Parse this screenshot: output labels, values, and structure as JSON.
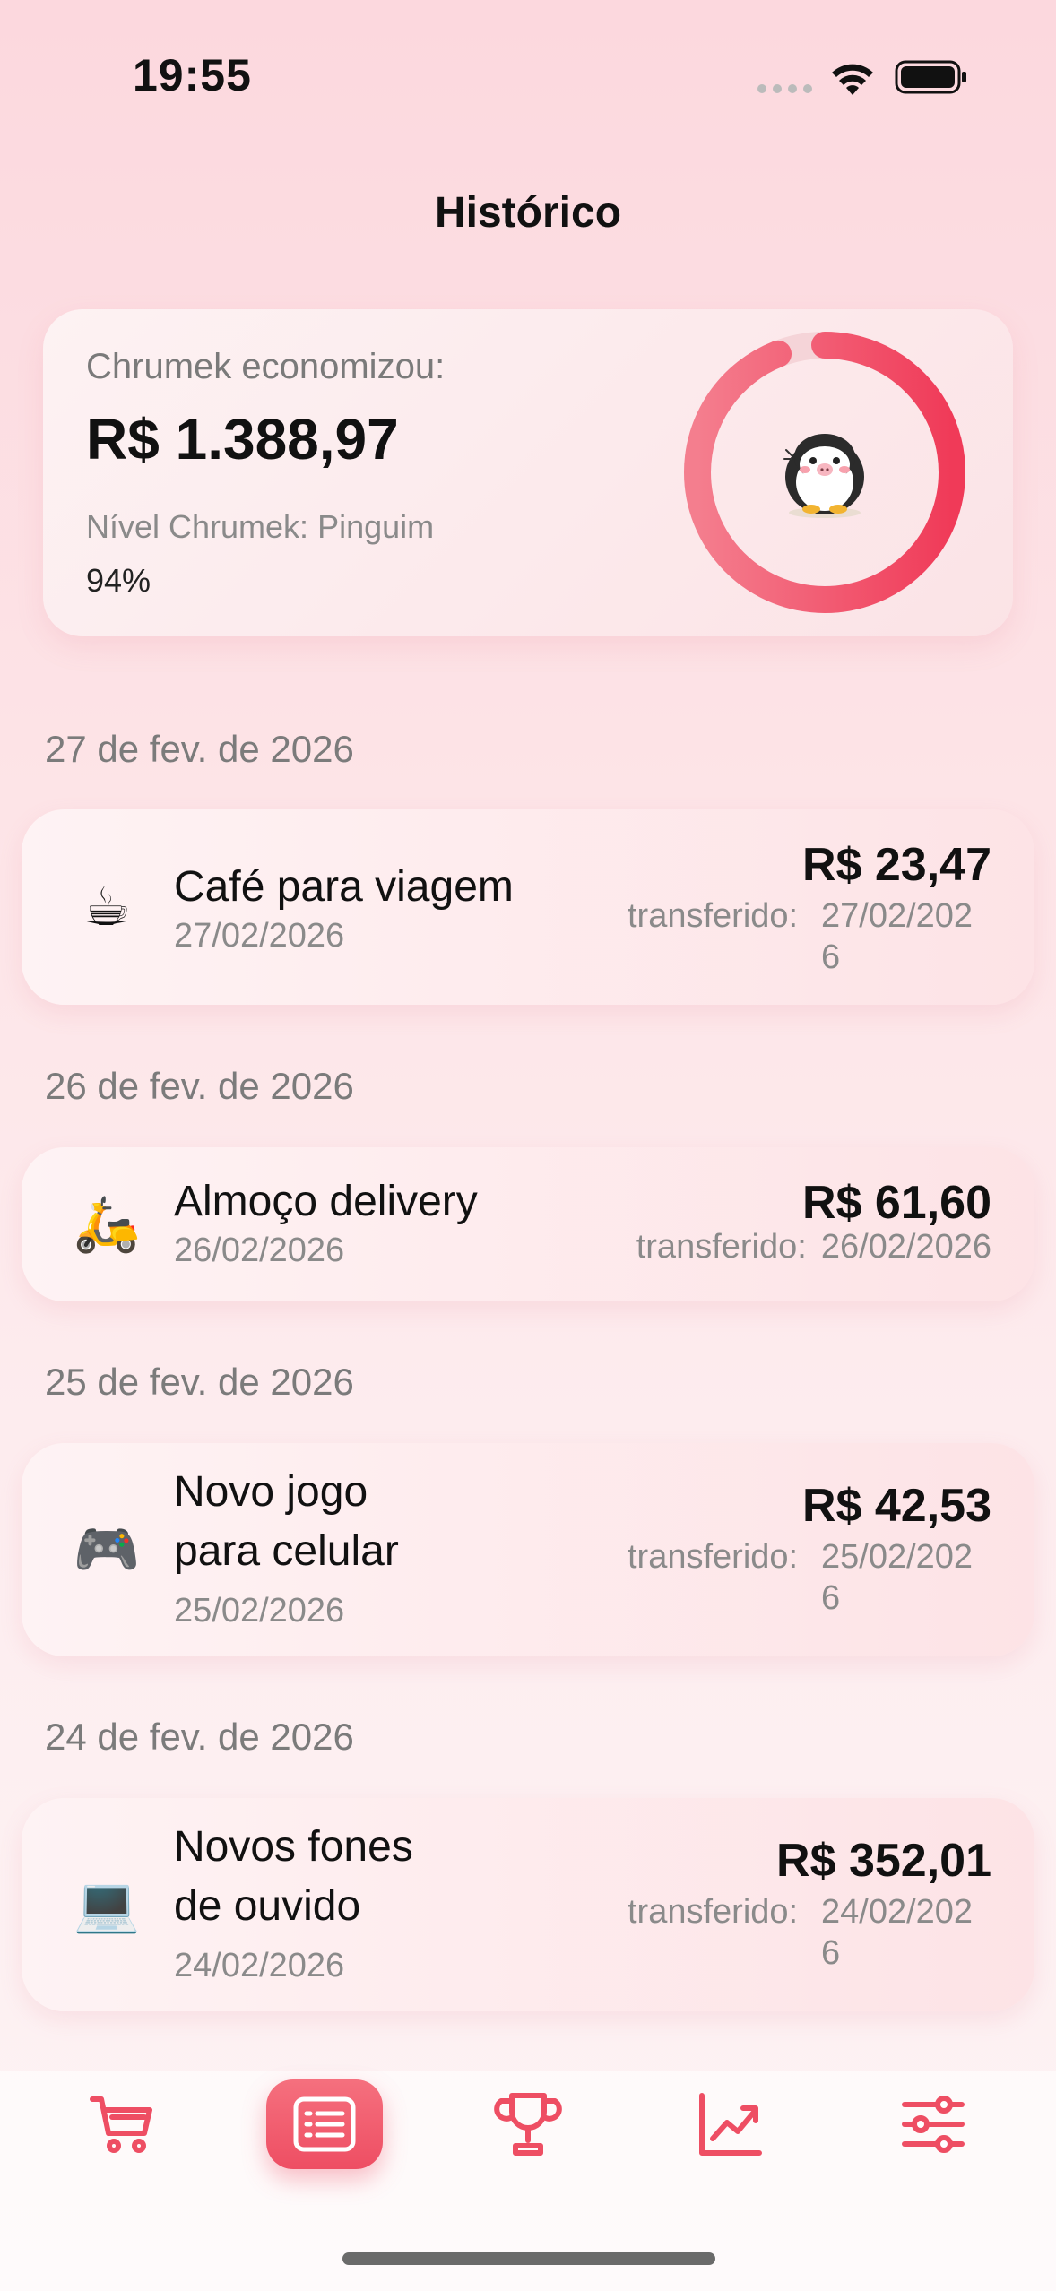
{
  "status_bar": {
    "time": "19:55"
  },
  "header": {
    "title": "Histórico"
  },
  "summary": {
    "label": "Chrumek economizou:",
    "amount": "R$ 1.388,97",
    "level": "Nível Chrumek: Pinguim",
    "percent_label": "94%",
    "progress": 0.94,
    "accent_color": "#f04a64",
    "mascot": "penguin-mascot"
  },
  "history": [
    {
      "date_header": "27 de fev. de 2026",
      "icon": "☕",
      "icon_name": "coffee-icon",
      "title": "Café para viagem",
      "date": "27/02/2026",
      "amount": "R$ 23,47",
      "transfer_label": "transferido:",
      "transfer_date": "27/02/2026"
    },
    {
      "date_header": "26 de fev. de 2026",
      "icon": "🛵",
      "icon_name": "scooter-icon",
      "title": "Almoço delivery",
      "date": "26/02/2026",
      "amount": "R$ 61,60",
      "transfer_label": "transferido:",
      "transfer_date": "26/02/2026"
    },
    {
      "date_header": "25 de fev. de 2026",
      "icon": "🎮",
      "icon_name": "gamepad-icon",
      "title": "Novo jogo para celular",
      "date": "25/02/2026",
      "amount": "R$ 42,53",
      "transfer_label": "transferido:",
      "transfer_date": "25/02/2026"
    },
    {
      "date_header": "24 de fev. de 2026",
      "icon": "💻",
      "icon_name": "laptop-icon",
      "title": "Novos fones de ouvido",
      "date": "24/02/2026",
      "amount": "R$ 352,01",
      "transfer_label": "transferido:",
      "transfer_date": "24/02/2026"
    }
  ],
  "nav": {
    "items": [
      "cart-icon",
      "history-list-icon",
      "trophy-icon",
      "chart-trend-icon",
      "sliders-icon"
    ],
    "active": "history-list-icon",
    "color": "#ee4e63"
  }
}
